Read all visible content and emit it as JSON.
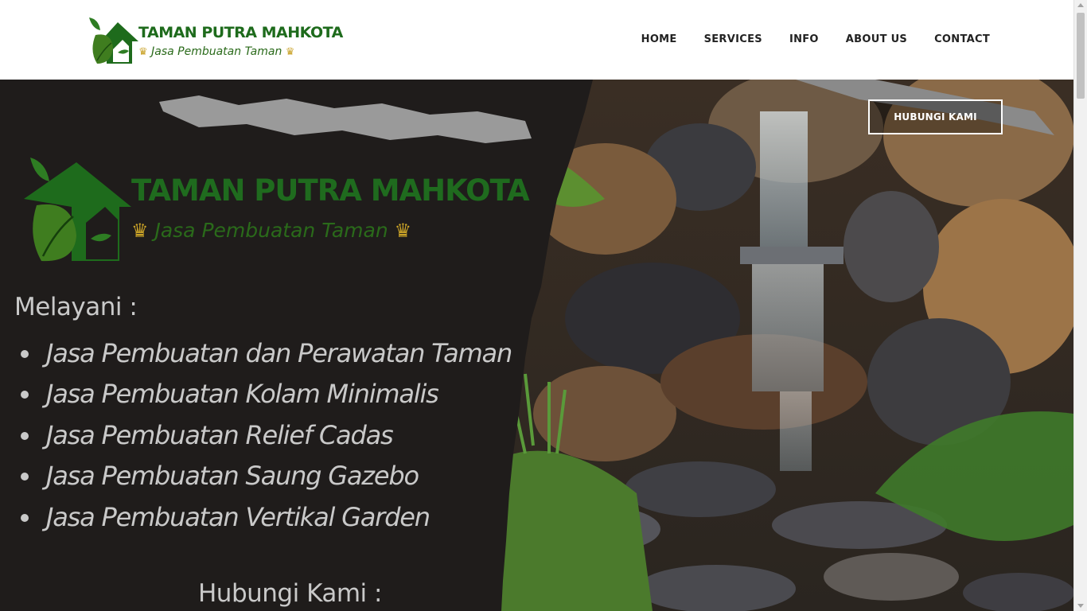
{
  "brand": {
    "title": "TAMAN PUTRA MAHKOTA",
    "tagline": "Jasa Pembuatan Taman",
    "crown_glyph": "♛",
    "color_primary": "#1e6b1c"
  },
  "nav": {
    "items": [
      {
        "label": "HOME"
      },
      {
        "label": "SERVICES"
      },
      {
        "label": "INFO"
      },
      {
        "label": "ABOUT US"
      },
      {
        "label": "CONTACT"
      }
    ]
  },
  "hero": {
    "cta_label": "HUBUNGI KAMI",
    "logo_title": "TAMAN PUTRA MAHKOTA",
    "logo_tagline": "Jasa Pembuatan Taman",
    "services_heading": "Melayani :",
    "services": [
      "Jasa Pembuatan dan Perawatan Taman",
      "Jasa Pembuatan Kolam Minimalis",
      "Jasa Pembuatan Relief Cadas",
      "Jasa Pembuatan Saung Gazebo",
      "Jasa Pembuatan Vertikal Garden"
    ],
    "contact_heading": "Hubungi Kami :"
  },
  "icons": {
    "logo": "house-leaf-logo-icon",
    "crown": "crown-icon",
    "bullet": "bullet-icon"
  }
}
